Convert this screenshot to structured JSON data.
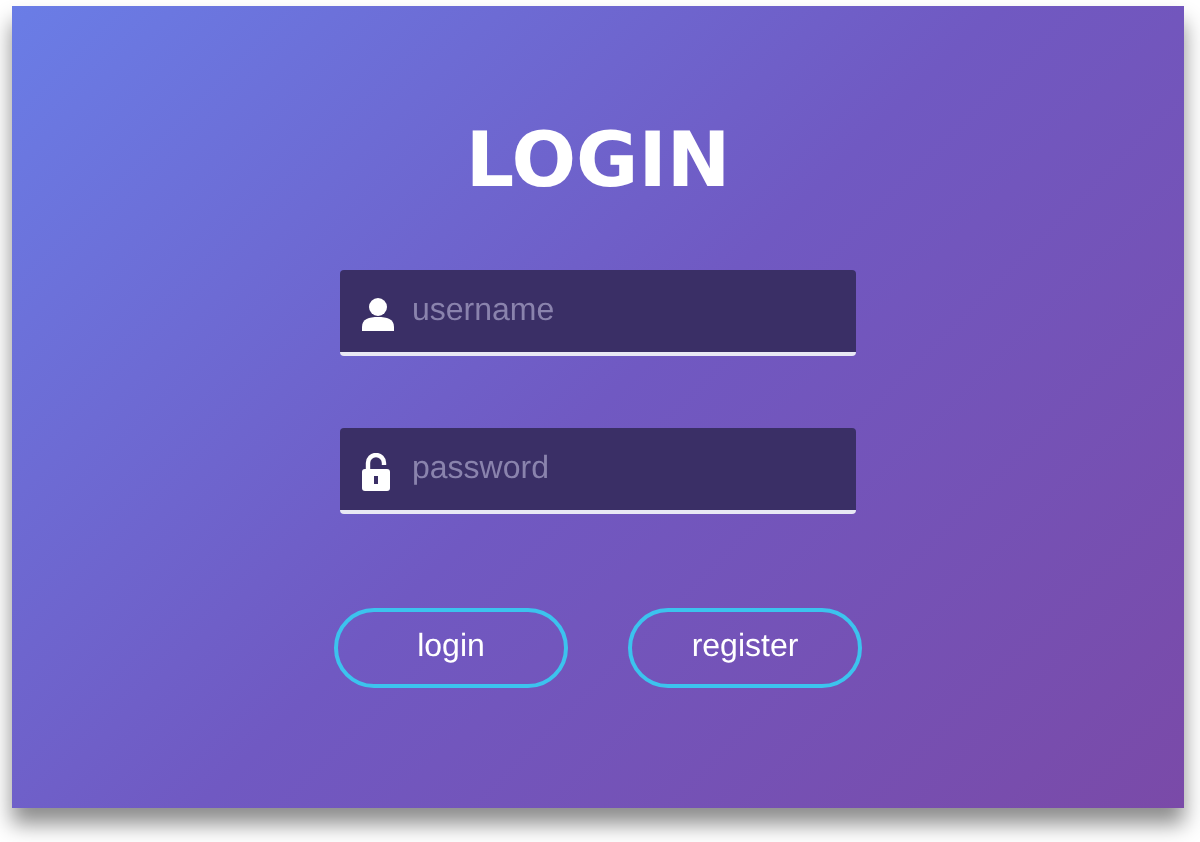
{
  "title": "LOGIN",
  "fields": [
    {
      "kind": "user",
      "placeholder": "username"
    },
    {
      "kind": "lock",
      "placeholder": "password"
    }
  ],
  "buttons": [
    "login",
    "register"
  ]
}
